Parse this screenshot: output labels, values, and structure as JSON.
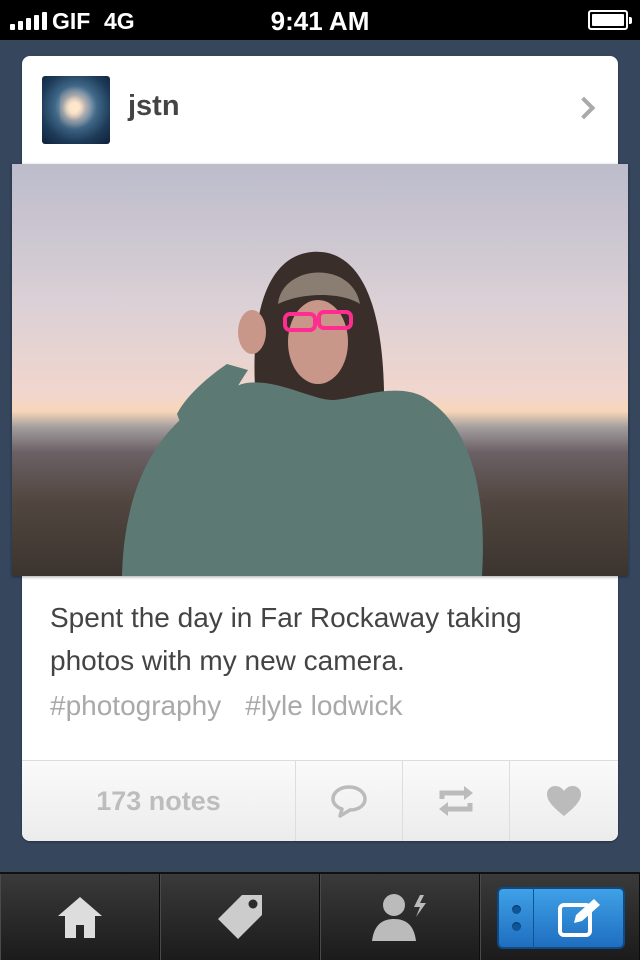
{
  "status_bar": {
    "carrier": "GIF",
    "network": "4G",
    "time": "9:41 AM"
  },
  "post": {
    "username": "jstn",
    "caption": "Spent the day in Far Rockaway taking photos with my new camera.",
    "tags": [
      "#photography",
      "#lyle lodwick"
    ],
    "notes": "173 notes"
  },
  "tabs": [
    {
      "icon": "home-icon"
    },
    {
      "icon": "tag-icon"
    },
    {
      "icon": "account-activity-icon"
    },
    {
      "icon": "compose-icon"
    }
  ],
  "colors": {
    "background": "#36465d",
    "compose_accent": "#2d86d6"
  }
}
